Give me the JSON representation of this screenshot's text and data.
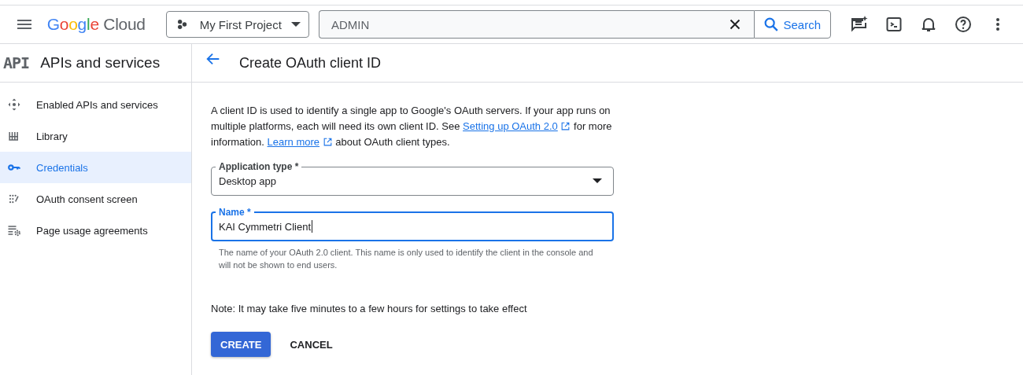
{
  "header": {
    "logo": {
      "word": "Google",
      "product": "Cloud"
    },
    "project": "My First Project",
    "search": {
      "value": "ADMIN",
      "button": "Search"
    }
  },
  "sidebar": {
    "badge": "API",
    "title": "APIs and services",
    "items": [
      {
        "label": "Enabled APIs and services",
        "selected": false
      },
      {
        "label": "Library",
        "selected": false
      },
      {
        "label": "Credentials",
        "selected": true
      },
      {
        "label": "OAuth consent screen",
        "selected": false
      },
      {
        "label": "Page usage agreements",
        "selected": false
      }
    ]
  },
  "page": {
    "title": "Create OAuth client ID",
    "description": [
      {
        "kind": "text",
        "text": "A client ID is used to identify a single app to Google's OAuth servers. If your app runs on multiple platforms, each will need its own client ID. See "
      },
      {
        "kind": "link",
        "text": "Setting up OAuth 2.0"
      },
      {
        "kind": "text",
        "text": " for more information. "
      },
      {
        "kind": "link",
        "text": "Learn more"
      },
      {
        "kind": "text",
        "text": " about OAuth client types."
      }
    ],
    "application_type": {
      "label": "Application type *",
      "value": "Desktop app"
    },
    "name": {
      "label": "Name *",
      "value": "KAI Cymmetri Client",
      "focused": true,
      "hint": "The name of your OAuth 2.0 client. This name is only used to identify the client in the console and will not be shown to end users."
    },
    "note": "Note: It may take five minutes to a few hours for settings to take effect",
    "buttons": [
      {
        "label": "CREATE",
        "kind": "primary"
      },
      {
        "label": "CANCEL",
        "kind": "text"
      }
    ]
  }
}
